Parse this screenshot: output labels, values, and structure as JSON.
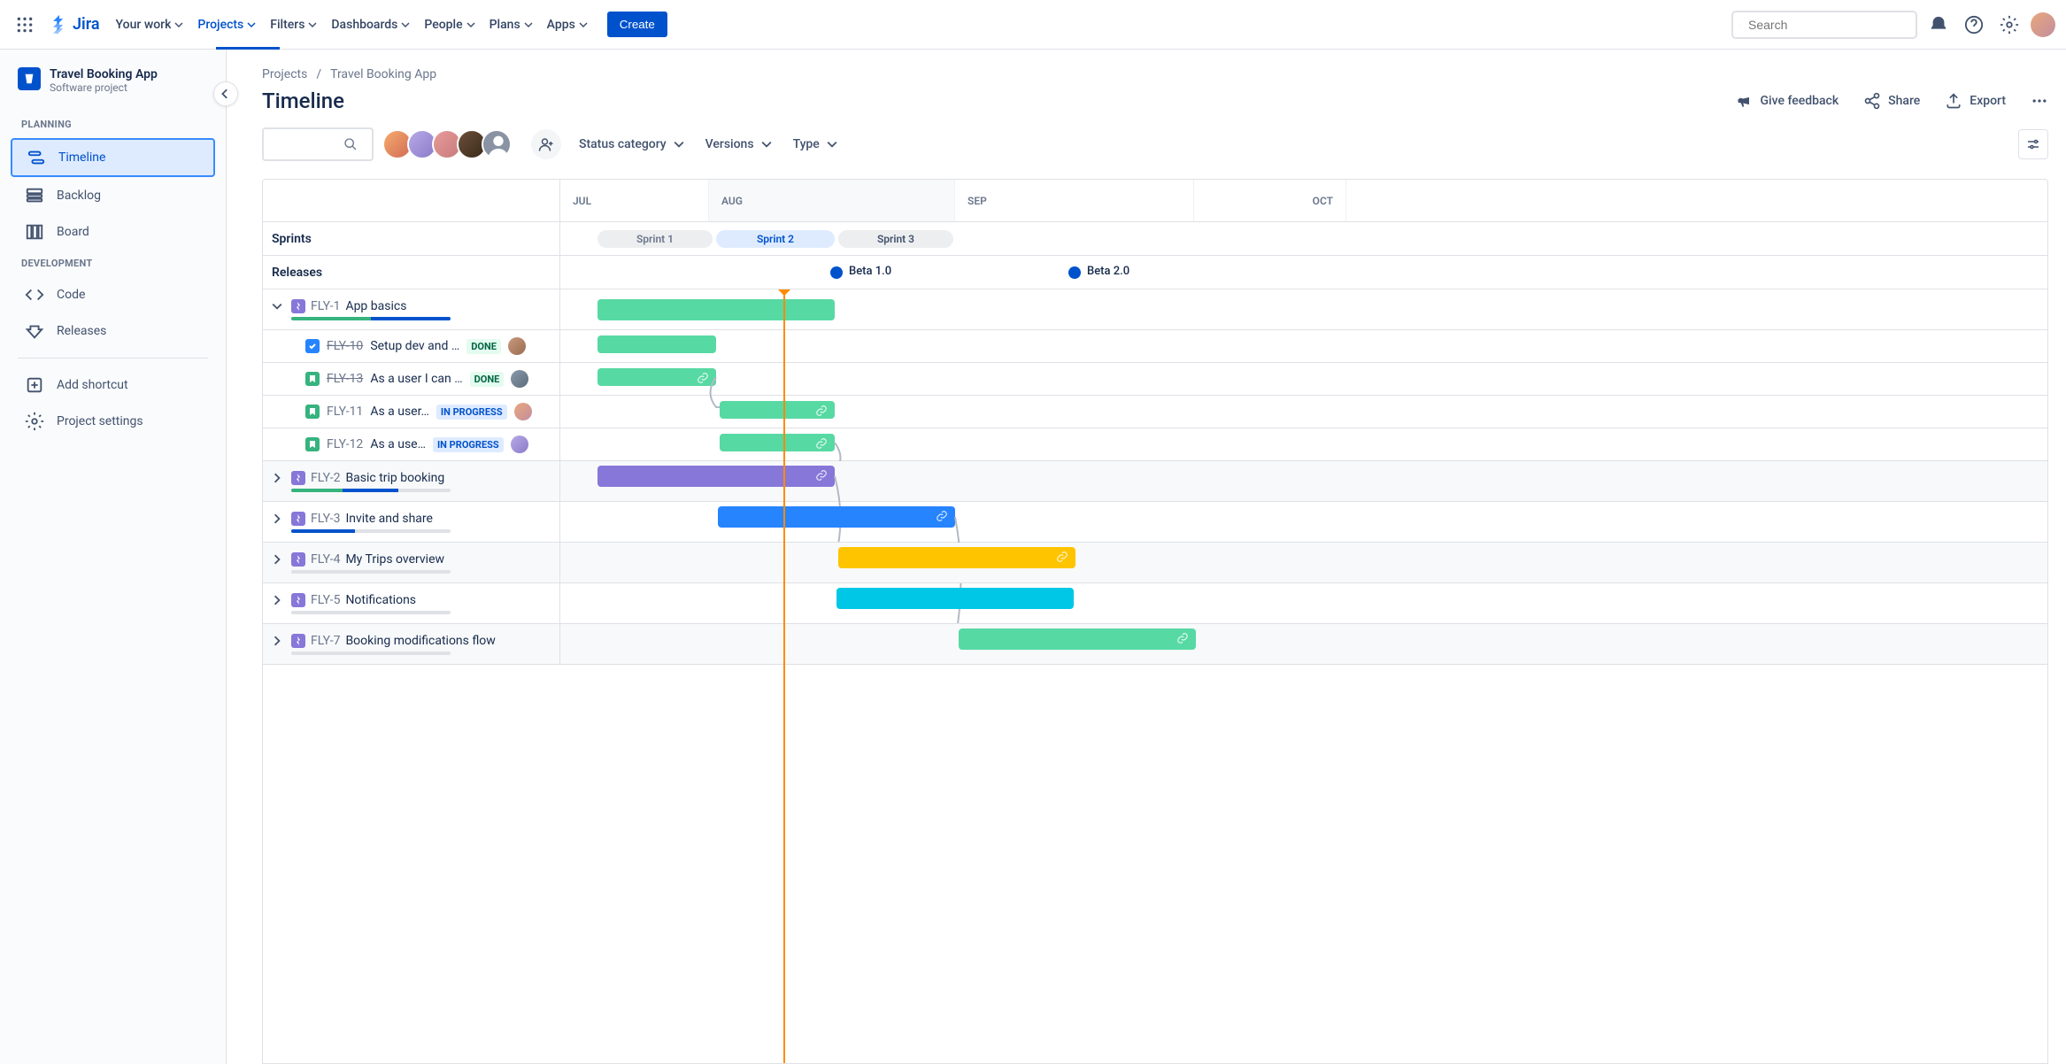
{
  "topnav": {
    "logo": "Jira",
    "items": [
      "Your work",
      "Projects",
      "Filters",
      "Dashboards",
      "People",
      "Plans",
      "Apps"
    ],
    "active_index": 1,
    "create": "Create",
    "search_placeholder": "Search"
  },
  "sidebar": {
    "project_name": "Travel Booking App",
    "project_type": "Software project",
    "sections": [
      {
        "label": "PLANNING",
        "items": [
          {
            "label": "Timeline",
            "selected": true
          },
          {
            "label": "Backlog"
          },
          {
            "label": "Board"
          }
        ]
      },
      {
        "label": "DEVELOPMENT",
        "items": [
          {
            "label": "Code"
          },
          {
            "label": "Releases"
          }
        ]
      }
    ],
    "footer_items": [
      "Add shortcut",
      "Project settings"
    ]
  },
  "breadcrumb": [
    "Projects",
    "Travel Booking App"
  ],
  "page_title": "Timeline",
  "title_actions": {
    "feedback": "Give feedback",
    "share": "Share",
    "export": "Export"
  },
  "filters": {
    "status": "Status category",
    "versions": "Versions",
    "type": "Type"
  },
  "timeline": {
    "months": [
      "JUL",
      "AUG",
      "SEP",
      "OCT"
    ],
    "shaded_month_index": 1,
    "sprints_label": "Sprints",
    "releases_label": "Releases",
    "sprints": [
      {
        "name": "Sprint 1",
        "state": "done"
      },
      {
        "name": "Sprint 2",
        "state": "active"
      },
      {
        "name": "Sprint 3",
        "state": "future"
      }
    ],
    "releases": [
      {
        "name": "Beta 1.0"
      },
      {
        "name": "Beta 2.0"
      }
    ],
    "epics": [
      {
        "key": "FLY-1",
        "title": "App basics",
        "expanded": true,
        "color": "green",
        "progress": {
          "green": 50,
          "blue": 50,
          "grey": 0
        },
        "children": [
          {
            "key": "FLY-10",
            "title": "Setup dev and …",
            "type": "task",
            "status": "DONE",
            "strike": true
          },
          {
            "key": "FLY-13",
            "title": "As a user I can …",
            "type": "story",
            "status": "DONE",
            "strike": true
          },
          {
            "key": "FLY-11",
            "title": "As a user…",
            "type": "story",
            "status": "IN PROGRESS"
          },
          {
            "key": "FLY-12",
            "title": "As a use…",
            "type": "story",
            "status": "IN PROGRESS"
          }
        ]
      },
      {
        "key": "FLY-2",
        "title": "Basic trip booking",
        "expanded": false,
        "color": "purple",
        "progress": {
          "green": 32,
          "blue": 35,
          "grey": 33
        }
      },
      {
        "key": "FLY-3",
        "title": "Invite and share",
        "expanded": false,
        "color": "blue",
        "progress": {
          "green": 0,
          "blue": 40,
          "grey": 60
        }
      },
      {
        "key": "FLY-4",
        "title": "My Trips overview",
        "expanded": false,
        "color": "yellow",
        "progress": {
          "green": 0,
          "blue": 0,
          "grey": 100
        }
      },
      {
        "key": "FLY-5",
        "title": "Notifications",
        "expanded": false,
        "color": "cyan",
        "progress": {
          "green": 0,
          "blue": 0,
          "grey": 100
        }
      },
      {
        "key": "FLY-7",
        "title": "Booking modifications flow",
        "expanded": false,
        "color": "green",
        "progress": {
          "green": 0,
          "blue": 0,
          "grey": 100
        }
      }
    ]
  }
}
